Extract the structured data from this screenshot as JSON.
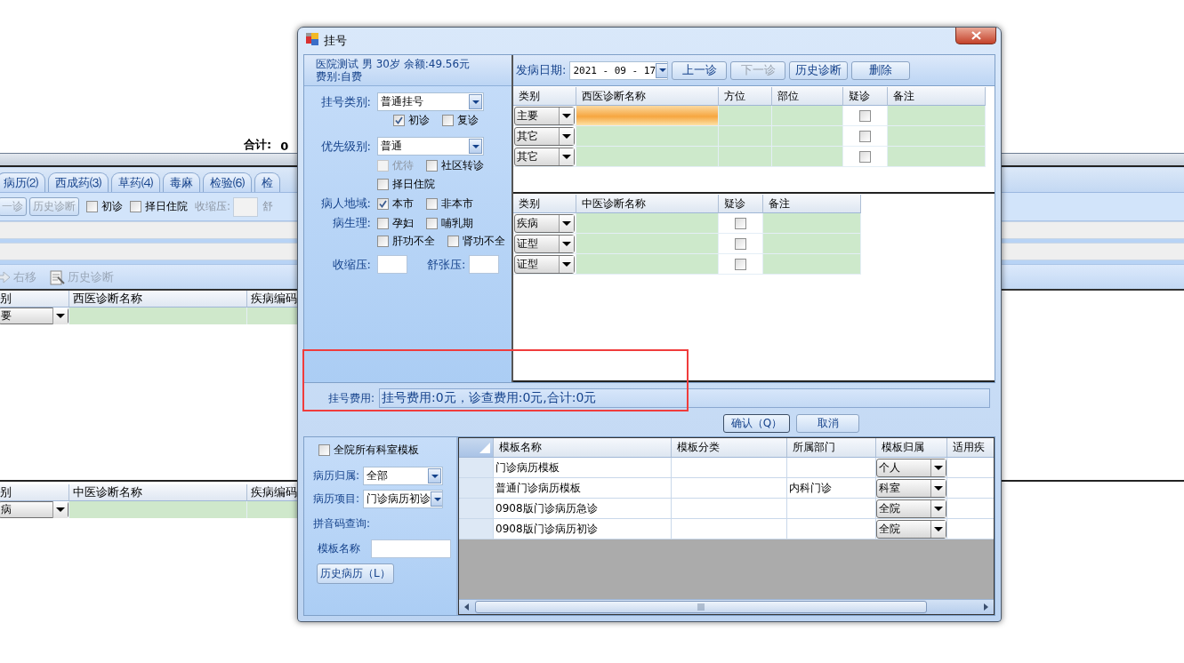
{
  "background_app": {
    "summary": {
      "label": "合计:",
      "value": "0"
    },
    "tabs": [
      {
        "label": "病历⑵",
        "selected": false
      },
      {
        "label": "西成药⑶",
        "selected": false
      },
      {
        "label": "草药⑷",
        "selected": false
      },
      {
        "label": "毒麻",
        "selected": false
      },
      {
        "label": "检验⑹",
        "selected": false
      },
      {
        "label": "检",
        "selected": false
      }
    ],
    "toolbar": [
      {
        "kind": "button",
        "label": "一诊",
        "disabled": true
      },
      {
        "kind": "button",
        "label": "历史诊断",
        "disabled": true
      },
      {
        "kind": "checkbox",
        "label": "初诊",
        "checked": false
      },
      {
        "kind": "checkbox",
        "label": "择日住院",
        "checked": false
      },
      {
        "kind": "field",
        "label": "收缩压:"
      },
      {
        "kind": "label",
        "label": "舒"
      }
    ],
    "actions": [
      {
        "kind": "move-right",
        "label": "右移",
        "disabled": true
      },
      {
        "kind": "history",
        "label": "历史诊断",
        "disabled": true
      }
    ],
    "western_table": {
      "columns": [
        "别",
        "西医诊断名称",
        "疾病编码"
      ],
      "rows": [
        {
          "type": "要"
        }
      ]
    },
    "chinese_table": {
      "columns": [
        "别",
        "中医诊断名称",
        "疾病编码"
      ],
      "rows": [
        {
          "type": "病"
        }
      ]
    }
  },
  "dialog": {
    "title": "挂号",
    "patient": {
      "line_1": "医院测试 男 30岁 余额:49.56元",
      "line_2": "费别:自费"
    },
    "registration_type": {
      "label": "挂号类别:",
      "value": "普通挂号"
    },
    "visit_checks": [
      {
        "label": "初诊",
        "checked": true
      },
      {
        "label": "复诊",
        "checked": false
      }
    ],
    "priority": {
      "label": "优先级别:",
      "value": "普通"
    },
    "priority_checks": [
      {
        "label": "优待",
        "checked": false,
        "disabled": true
      },
      {
        "label": "社区转诊",
        "checked": false,
        "disabled": false
      }
    ],
    "admission_check": {
      "label": "择日住院",
      "checked": false
    },
    "region": {
      "label": "病人地域:",
      "options": [
        {
          "label": "本市",
          "checked": true
        },
        {
          "label": "非本市",
          "checked": false
        }
      ]
    },
    "physiology": {
      "label": "病生理:",
      "options": [
        {
          "label": "孕妇",
          "checked": false
        },
        {
          "label": "哺乳期",
          "checked": false
        },
        {
          "label": "肝功不全",
          "checked": false
        },
        {
          "label": "肾功不全",
          "checked": false
        }
      ]
    },
    "systolic": {
      "label": "收缩压:"
    },
    "diastolic": {
      "label": "舒张压:"
    },
    "onset_date": {
      "label": "发病日期:",
      "value": "2021 - 09 - 17"
    },
    "buttons": [
      {
        "label": "上一诊",
        "disabled": false
      },
      {
        "label": "下一诊",
        "disabled": true
      },
      {
        "label": "历史诊断",
        "disabled": false
      },
      {
        "label": "删除",
        "disabled": false
      }
    ],
    "western_grid": {
      "columns": [
        "类别",
        "西医诊断名称",
        "方位",
        "部位",
        "疑诊",
        "备注"
      ],
      "rows": [
        {
          "type": "主要",
          "selected": true,
          "suspected": false
        },
        {
          "type": "其它",
          "selected": false,
          "suspected": false
        },
        {
          "type": "其它",
          "selected": false,
          "suspected": false
        }
      ]
    },
    "chinese_grid": {
      "columns": [
        "类别",
        "中医诊断名称",
        "疑诊",
        "备注"
      ],
      "rows": [
        {
          "type": "疾病",
          "suspected": false
        },
        {
          "type": "证型",
          "suspected": false
        },
        {
          "type": "证型",
          "suspected": false
        }
      ]
    },
    "fee": {
      "label": "挂号费用:",
      "value": "挂号费用:0元，诊查费用:0元,合计:0元"
    },
    "confirm": "确认（Q）",
    "cancel": "取消",
    "templates": {
      "all_departments": {
        "label": "全院所有科室模板",
        "checked": false
      },
      "ownership": {
        "label": "病历归属:",
        "value": "全部"
      },
      "item": {
        "label": "病历项目:",
        "value": "门诊病历初诊"
      },
      "pinyin_label": "拼音码查询:",
      "name_field": {
        "label": "模板名称"
      },
      "history_button": "历史病历（L）",
      "table": {
        "columns": [
          "模板名称",
          "模板分类",
          "所属部门",
          "模板归属",
          "适用疾"
        ],
        "rows": [
          {
            "name": "门诊病历模板",
            "ownership": "个人"
          },
          {
            "name": "普通门诊病历模板",
            "department": "内科门诊",
            "ownership": "科室"
          },
          {
            "name": "0908版门诊病历急诊",
            "ownership": "全院"
          },
          {
            "name": "0908版门诊病历初诊",
            "ownership": "全院"
          }
        ]
      }
    }
  }
}
